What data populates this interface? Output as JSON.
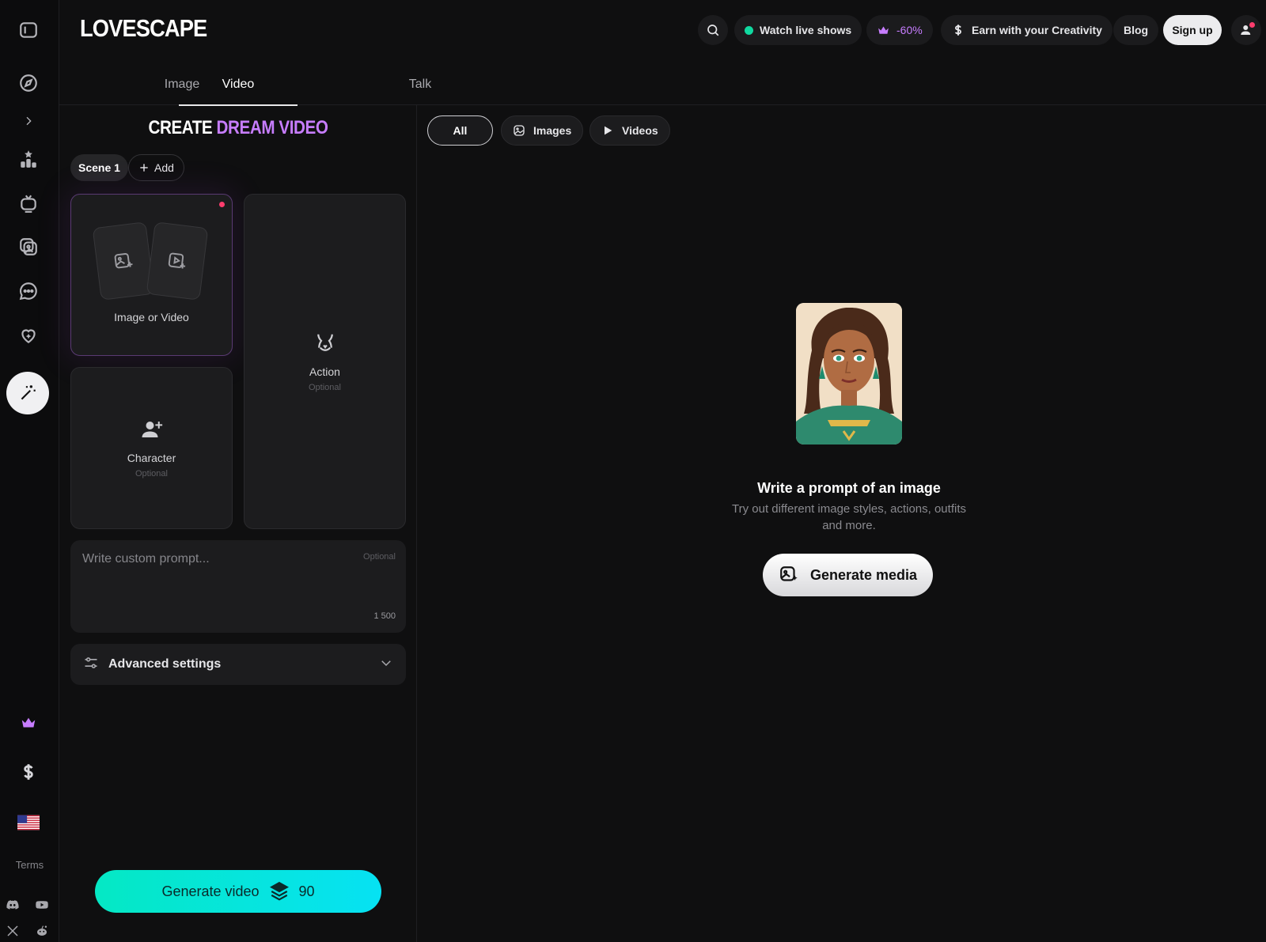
{
  "brand": {
    "logo": "LOVESCAPE"
  },
  "header": {
    "watch_live": "Watch live shows",
    "discount": "-60%",
    "earn": "Earn with your Creativity",
    "blog": "Blog",
    "signup": "Sign up"
  },
  "tabs": [
    {
      "label": "Image"
    },
    {
      "label": "Video",
      "active": true
    },
    {
      "label": "Talk"
    }
  ],
  "create": {
    "title_white": "CREATE",
    "title_purple": "DREAM VIDEO",
    "scene_label": "Scene 1",
    "add_label": "Add",
    "media_card": {
      "label": "Image or Video"
    },
    "action_card": {
      "label": "Action",
      "optional": "Optional"
    },
    "character_card": {
      "label": "Character",
      "optional": "Optional"
    },
    "prompt": {
      "placeholder": "Write custom prompt...",
      "optional": "Optional",
      "char_limit": "1 500"
    },
    "advanced": {
      "label": "Advanced settings"
    },
    "generate": {
      "label": "Generate video",
      "cost": "90"
    }
  },
  "rail": {
    "terms": "Terms",
    "icons": [
      "sidebar-toggle-icon",
      "compass-icon",
      "chevron-right-icon",
      "leaderboard-icon",
      "tv-icon",
      "gallery-icon",
      "chat-icon",
      "heart-sparkle-icon",
      "magic-wand-icon",
      "crown-icon",
      "dollar-icon",
      "us-flag-icon",
      "discord-icon",
      "youtube-icon",
      "x-icon",
      "reddit-icon"
    ]
  },
  "filters": [
    {
      "label": "All",
      "active": true
    },
    {
      "label": "Images"
    },
    {
      "label": "Videos"
    }
  ],
  "empty_state": {
    "title": "Write a prompt of an image",
    "subtitle": "Try out different image styles, actions, outfits and more.",
    "button": "Generate media"
  },
  "colors": {
    "accent_purple": "#c77dff",
    "accent_cyan": "#05e8c4",
    "live_green": "#10d9a0",
    "notification_red": "#ff3d6e"
  }
}
